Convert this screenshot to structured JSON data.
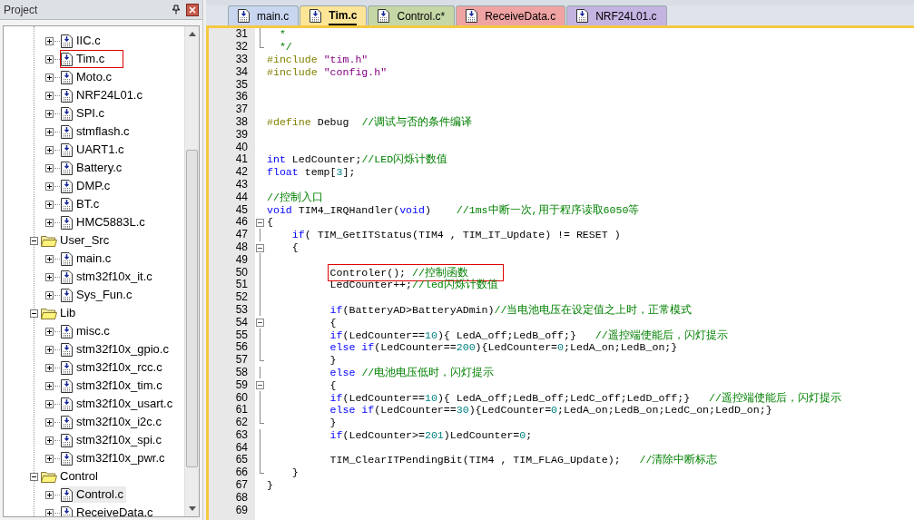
{
  "project_panel": {
    "title": "Project",
    "tree": [
      {
        "kind": "group",
        "children": [
          {
            "kind": "file",
            "label": "IIC.c",
            "expanded": false,
            "selected": false,
            "boxed": false
          },
          {
            "kind": "file",
            "label": "Tim.c",
            "expanded": false,
            "selected": false,
            "boxed": true
          },
          {
            "kind": "file",
            "label": "Moto.c",
            "expanded": false,
            "selected": false,
            "boxed": false
          },
          {
            "kind": "file",
            "label": "NRF24L01.c",
            "expanded": false,
            "selected": false,
            "boxed": false
          },
          {
            "kind": "file",
            "label": "SPI.c",
            "expanded": false,
            "selected": false,
            "boxed": false
          },
          {
            "kind": "file",
            "label": "stmflash.c",
            "expanded": false,
            "selected": false,
            "boxed": false
          },
          {
            "kind": "file",
            "label": "UART1.c",
            "expanded": false,
            "selected": false,
            "boxed": false
          },
          {
            "kind": "file",
            "label": "Battery.c",
            "expanded": false,
            "selected": false,
            "boxed": false
          },
          {
            "kind": "file",
            "label": "DMP.c",
            "expanded": false,
            "selected": false,
            "boxed": false
          },
          {
            "kind": "file",
            "label": "BT.c",
            "expanded": false,
            "selected": false,
            "boxed": false
          },
          {
            "kind": "file",
            "label": "HMC5883L.c",
            "expanded": false,
            "selected": false,
            "boxed": false
          }
        ]
      },
      {
        "kind": "folder",
        "label": "User_Src",
        "expanded": true,
        "children": [
          {
            "kind": "file",
            "label": "main.c",
            "expanded": false,
            "selected": false,
            "boxed": false
          },
          {
            "kind": "file",
            "label": "stm32f10x_it.c",
            "expanded": false,
            "selected": false,
            "boxed": false
          },
          {
            "kind": "file",
            "label": "Sys_Fun.c",
            "expanded": false,
            "selected": false,
            "boxed": false
          }
        ]
      },
      {
        "kind": "folder",
        "label": "Lib",
        "expanded": true,
        "children": [
          {
            "kind": "file",
            "label": "misc.c",
            "expanded": false,
            "selected": false,
            "boxed": false
          },
          {
            "kind": "file",
            "label": "stm32f10x_gpio.c",
            "expanded": false,
            "selected": false,
            "boxed": false
          },
          {
            "kind": "file",
            "label": "stm32f10x_rcc.c",
            "expanded": false,
            "selected": false,
            "boxed": false
          },
          {
            "kind": "file",
            "label": "stm32f10x_tim.c",
            "expanded": false,
            "selected": false,
            "boxed": false
          },
          {
            "kind": "file",
            "label": "stm32f10x_usart.c",
            "expanded": false,
            "selected": false,
            "boxed": false
          },
          {
            "kind": "file",
            "label": "stm32f10x_i2c.c",
            "expanded": false,
            "selected": false,
            "boxed": false
          },
          {
            "kind": "file",
            "label": "stm32f10x_spi.c",
            "expanded": false,
            "selected": false,
            "boxed": false
          },
          {
            "kind": "file",
            "label": "stm32f10x_pwr.c",
            "expanded": false,
            "selected": false,
            "boxed": false
          }
        ]
      },
      {
        "kind": "folder",
        "label": "Control",
        "expanded": true,
        "children": [
          {
            "kind": "file",
            "label": "Control.c",
            "expanded": false,
            "selected": true,
            "boxed": false
          },
          {
            "kind": "file",
            "label": "ReceiveData.c",
            "expanded": false,
            "selected": false,
            "boxed": false
          }
        ]
      }
    ]
  },
  "tabs": [
    {
      "label": "main.c",
      "selected": false,
      "color": "#c9d6f0"
    },
    {
      "label": "Tim.c",
      "selected": true,
      "color": "#fde597"
    },
    {
      "label": "Control.c*",
      "selected": false,
      "color": "#c6d7a6"
    },
    {
      "label": "ReceiveData.c",
      "selected": false,
      "color": "#f0a3a3"
    },
    {
      "label": "NRF24L01.c",
      "selected": false,
      "color": "#c4b4e2"
    }
  ],
  "editor": {
    "lines": [
      {
        "n": "31",
        "in_fold": true,
        "tokens": [
          {
            "kind": "comment",
            "t": "  *"
          }
        ]
      },
      {
        "n": "32",
        "fold_end": true,
        "tokens": [
          {
            "kind": "comment",
            "t": "  */"
          }
        ]
      },
      {
        "n": "33",
        "tokens": [
          {
            "kind": "directive",
            "t": "#include "
          },
          {
            "kind": "string",
            "t": "\"tim.h\""
          }
        ]
      },
      {
        "n": "34",
        "tokens": [
          {
            "kind": "directive",
            "t": "#include "
          },
          {
            "kind": "string",
            "t": "\"config.h\""
          }
        ]
      },
      {
        "n": "35"
      },
      {
        "n": "36"
      },
      {
        "n": "37"
      },
      {
        "n": "38",
        "tokens": [
          {
            "kind": "directive",
            "t": "#define "
          },
          {
            "kind": "plain",
            "t": "Debug  "
          },
          {
            "kind": "comment",
            "t": "//调试与否的条件编译"
          }
        ]
      },
      {
        "n": "39"
      },
      {
        "n": "40"
      },
      {
        "n": "41",
        "tokens": [
          {
            "kind": "keyword",
            "t": "int "
          },
          {
            "kind": "plain",
            "t": "LedCounter;"
          },
          {
            "kind": "comment",
            "t": "//LED闪烁计数值"
          }
        ]
      },
      {
        "n": "42",
        "tokens": [
          {
            "kind": "keyword",
            "t": "float "
          },
          {
            "kind": "plain",
            "t": "temp["
          },
          {
            "kind": "number",
            "t": "3"
          },
          {
            "kind": "plain",
            "t": "];"
          }
        ]
      },
      {
        "n": "43"
      },
      {
        "n": "44",
        "tokens": [
          {
            "kind": "comment",
            "t": "//控制入口"
          }
        ]
      },
      {
        "n": "45",
        "tokens": [
          {
            "kind": "keyword",
            "t": "void "
          },
          {
            "kind": "plain",
            "t": "TIM4_IRQHandler("
          },
          {
            "kind": "keyword",
            "t": "void"
          },
          {
            "kind": "plain",
            "t": ")    "
          },
          {
            "kind": "comment",
            "t": "//1ms中断一次,用于程序读取6050等"
          }
        ]
      },
      {
        "n": "46",
        "fold_start": true,
        "tokens": [
          {
            "kind": "plain",
            "t": "{"
          }
        ]
      },
      {
        "n": "47",
        "in_fold": true,
        "tokens": [
          {
            "kind": "keyword",
            "t": "    if"
          },
          {
            "kind": "plain",
            "t": "( TIM_GetITStatus(TIM4 , TIM_IT_Update) != RESET )"
          }
        ]
      },
      {
        "n": "48",
        "fold_start": true,
        "tokens": [
          {
            "kind": "plain",
            "t": "    {"
          }
        ]
      },
      {
        "n": "49",
        "in_fold": true
      },
      {
        "n": "50",
        "in_fold": true,
        "boxed": true,
        "tokens": [
          {
            "kind": "plain",
            "t": "          Controler(); "
          },
          {
            "kind": "comment",
            "t": "//控制函数"
          }
        ]
      },
      {
        "n": "51",
        "in_fold": true,
        "tokens": [
          {
            "kind": "plain",
            "t": "          LedCounter++;"
          },
          {
            "kind": "comment",
            "t": "//led闪烁计数值"
          }
        ]
      },
      {
        "n": "52",
        "in_fold": true
      },
      {
        "n": "53",
        "in_fold": true,
        "tokens": [
          {
            "kind": "keyword",
            "t": "          if"
          },
          {
            "kind": "plain",
            "t": "(BatteryAD>BatteryADmin)"
          },
          {
            "kind": "comment",
            "t": "//当电池电压在设定值之上时，正常模式"
          }
        ]
      },
      {
        "n": "54",
        "fold_start": true,
        "tokens": [
          {
            "kind": "plain",
            "t": "          {"
          }
        ]
      },
      {
        "n": "55",
        "in_fold": true,
        "tokens": [
          {
            "kind": "keyword",
            "t": "          if"
          },
          {
            "kind": "plain",
            "t": "(LedCounter=="
          },
          {
            "kind": "number",
            "t": "10"
          },
          {
            "kind": "plain",
            "t": "){ LedA_off;LedB_off;}   "
          },
          {
            "kind": "comment",
            "t": "//遥控端使能后，闪灯提示"
          }
        ]
      },
      {
        "n": "56",
        "in_fold": true,
        "tokens": [
          {
            "kind": "keyword",
            "t": "          else if"
          },
          {
            "kind": "plain",
            "t": "(LedCounter=="
          },
          {
            "kind": "number",
            "t": "200"
          },
          {
            "kind": "plain",
            "t": "){LedCounter="
          },
          {
            "kind": "number",
            "t": "0"
          },
          {
            "kind": "plain",
            "t": ";LedA_on;LedB_on;}"
          }
        ]
      },
      {
        "n": "57",
        "fold_end": true,
        "tokens": [
          {
            "kind": "plain",
            "t": "          }"
          }
        ]
      },
      {
        "n": "58",
        "in_fold": true,
        "tokens": [
          {
            "kind": "keyword",
            "t": "          else "
          },
          {
            "kind": "comment",
            "t": "//电池电压低时，闪灯提示"
          }
        ]
      },
      {
        "n": "59",
        "fold_start": true,
        "tokens": [
          {
            "kind": "plain",
            "t": "          {"
          }
        ]
      },
      {
        "n": "60",
        "in_fold": true,
        "tokens": [
          {
            "kind": "keyword",
            "t": "          if"
          },
          {
            "kind": "plain",
            "t": "(LedCounter=="
          },
          {
            "kind": "number",
            "t": "10"
          },
          {
            "kind": "plain",
            "t": "){ LedA_off;LedB_off;LedC_off;LedD_off;}   "
          },
          {
            "kind": "comment",
            "t": "//遥控端使能后，闪灯提示"
          }
        ]
      },
      {
        "n": "61",
        "in_fold": true,
        "tokens": [
          {
            "kind": "keyword",
            "t": "          else if"
          },
          {
            "kind": "plain",
            "t": "(LedCounter=="
          },
          {
            "kind": "number",
            "t": "30"
          },
          {
            "kind": "plain",
            "t": "){LedCounter="
          },
          {
            "kind": "number",
            "t": "0"
          },
          {
            "kind": "plain",
            "t": ";LedA_on;LedB_on;LedC_on;LedD_on;}"
          }
        ]
      },
      {
        "n": "62",
        "fold_end": true,
        "tokens": [
          {
            "kind": "plain",
            "t": "          }"
          }
        ]
      },
      {
        "n": "63",
        "in_fold": true,
        "tokens": [
          {
            "kind": "keyword",
            "t": "          if"
          },
          {
            "kind": "plain",
            "t": "(LedCounter>="
          },
          {
            "kind": "number",
            "t": "201"
          },
          {
            "kind": "plain",
            "t": ")LedCounter="
          },
          {
            "kind": "number",
            "t": "0"
          },
          {
            "kind": "plain",
            "t": ";"
          }
        ]
      },
      {
        "n": "64",
        "in_fold": true
      },
      {
        "n": "65",
        "in_fold": true,
        "tokens": [
          {
            "kind": "plain",
            "t": "          TIM_ClearITPendingBit(TIM4 , TIM_FLAG_Update);   "
          },
          {
            "kind": "comment",
            "t": "//清除中断标志"
          }
        ]
      },
      {
        "n": "66",
        "fold_end": true,
        "tokens": [
          {
            "kind": "plain",
            "t": "    }"
          }
        ]
      },
      {
        "n": "67",
        "tokens": [
          {
            "kind": "plain",
            "t": "}"
          }
        ]
      },
      {
        "n": "68"
      },
      {
        "n": "69"
      }
    ]
  }
}
